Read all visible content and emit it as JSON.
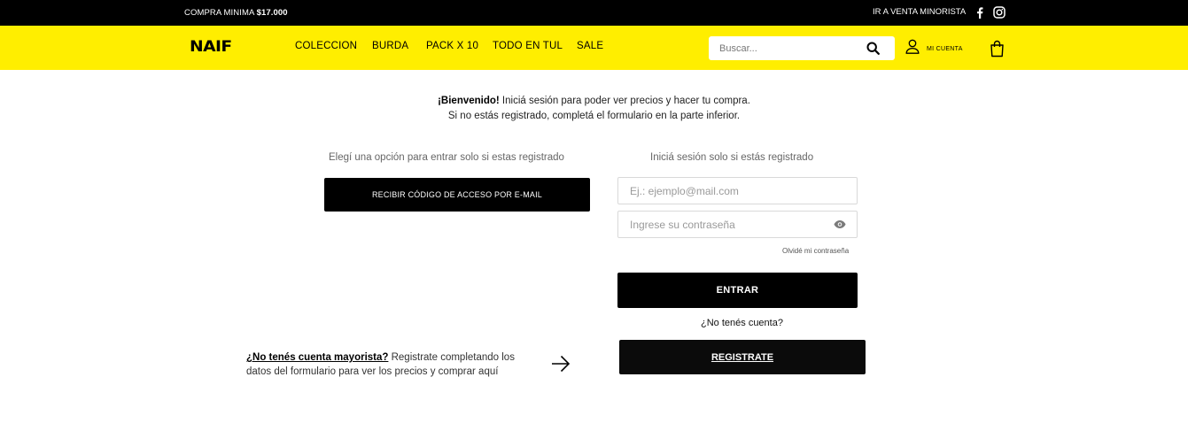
{
  "topbar": {
    "promo_prefix": "COMPRA MINIMA ",
    "promo_amount": "$17.000",
    "retail_link": "IR A VENTA MINORISTA",
    "social": [
      "facebook-icon",
      "instagram-icon"
    ]
  },
  "header": {
    "logo": "NAIF",
    "nav": [
      "COLECCION",
      "BURDA",
      "PACK X 10",
      "TODO EN TUL",
      "SALE"
    ],
    "search_placeholder": "Buscar...",
    "account_label": "MI CUENTA",
    "brand_color": "#ffee00"
  },
  "welcome": {
    "bold": "¡Bienvenido!",
    "line1_rest": " Iniciá sesión para poder ver precios y hacer tu compra.",
    "line2": "Si no estás registrado, completá el formulario en la parte inferior."
  },
  "left_col": {
    "title": "Elegí una opción para entrar solo si estas registrado",
    "code_button": "RECIBIR CÓDIGO DE ACCESO POR E-MAIL"
  },
  "login": {
    "title": "Iniciá sesión solo si estás registrado",
    "email_placeholder": "Ej.: ejemplo@mail.com",
    "password_placeholder": "Ingrese su contraseña",
    "forgot": "Olvidé mi contraseña",
    "enter_button": "ENTRAR",
    "no_account": "¿No tenés cuenta?",
    "register_button": "REGISTRATE"
  },
  "wholesale": {
    "link": "¿No tenés cuenta mayorista?",
    "text": " Registrate completando los datos del formulario para ver los precios y comprar aquí"
  }
}
